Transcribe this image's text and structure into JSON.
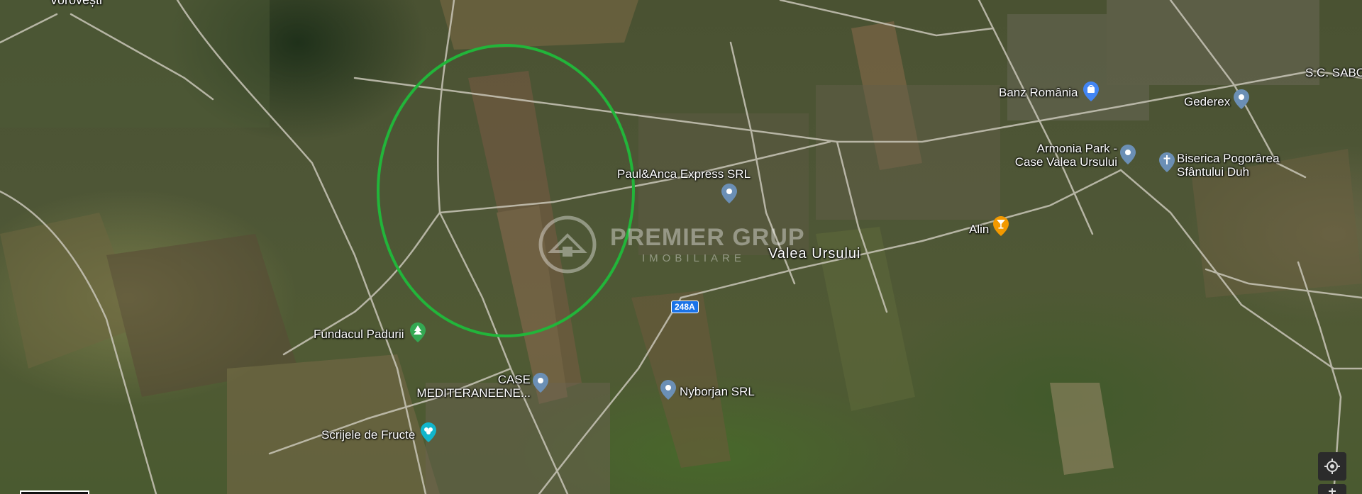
{
  "map": {
    "top_partial_label": "Vorovești",
    "area_label": "Valea Ursului",
    "road_shield": "248A",
    "watermark": {
      "brand": "PREMIER GRUP",
      "sub": "IMOBILIARE"
    },
    "places": [
      {
        "name": "Banz România",
        "icon": "shopping-bag-icon",
        "color": "#4285f4"
      },
      {
        "name": "Gederex",
        "icon": "map-pin-icon",
        "color": "#6b8fb5"
      },
      {
        "name": "S.C. SABO",
        "icon": "map-pin-icon",
        "color": "#6b8fb5"
      },
      {
        "name_line1": "Armonia Park -",
        "name_line2": "Case Valea Ursului",
        "icon": "map-pin-icon",
        "color": "#6b8fb5"
      },
      {
        "name_line1": "Biserica Pogorârea",
        "name_line2": "Sfântului Duh",
        "icon": "church-cross-icon",
        "color": "#6b8fb5"
      },
      {
        "name": "Paul&Anca Express SRL",
        "icon": "map-pin-icon",
        "color": "#6b8fb5"
      },
      {
        "name": "Alin",
        "icon": "bar-cocktail-icon",
        "color": "#f29900"
      },
      {
        "name": "Fundacul Padurii",
        "icon": "tree-park-icon",
        "color": "#34a853"
      },
      {
        "name_line1": "CASE",
        "name_line2": "MEDITERANEENE...",
        "icon": "map-pin-icon",
        "color": "#6b8fb5"
      },
      {
        "name": "Nyborjan SRL",
        "icon": "map-pin-icon",
        "color": "#6b8fb5"
      },
      {
        "name": "Scrijele de Fructe",
        "icon": "grocery-store-icon",
        "color": "#12b5cb"
      }
    ],
    "highlight_circle_color": "#22b53a",
    "controls": {
      "locate": "my-location-icon"
    }
  }
}
